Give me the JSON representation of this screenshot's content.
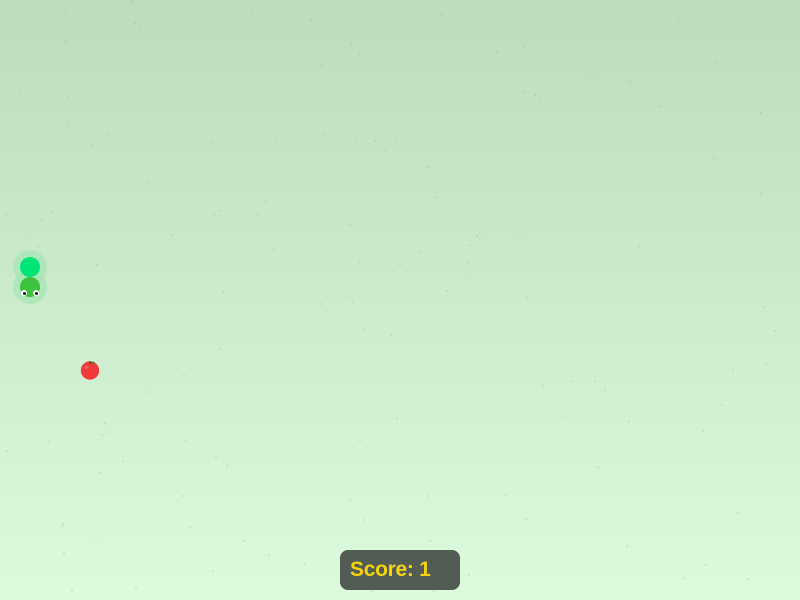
{
  "score": {
    "label": "Score",
    "value": 1,
    "display": "Score: 1"
  },
  "snake": {
    "length": 2,
    "direction": "down"
  },
  "food": {
    "type": "apple",
    "icon": "apple-icon"
  },
  "colors": {
    "background_top": "#bddbbd",
    "background_bottom": "#dcfbdc",
    "snake_tail": "#00e676",
    "snake_head": "#3cc23c",
    "snake_glow": "#a5e6b4",
    "apple_body": "#f03a3a",
    "apple_stem": "#5a3a1a",
    "apple_leaf": "#2e7d32",
    "score_panel_bg": "#525c52",
    "score_text": "#f5d40f"
  }
}
